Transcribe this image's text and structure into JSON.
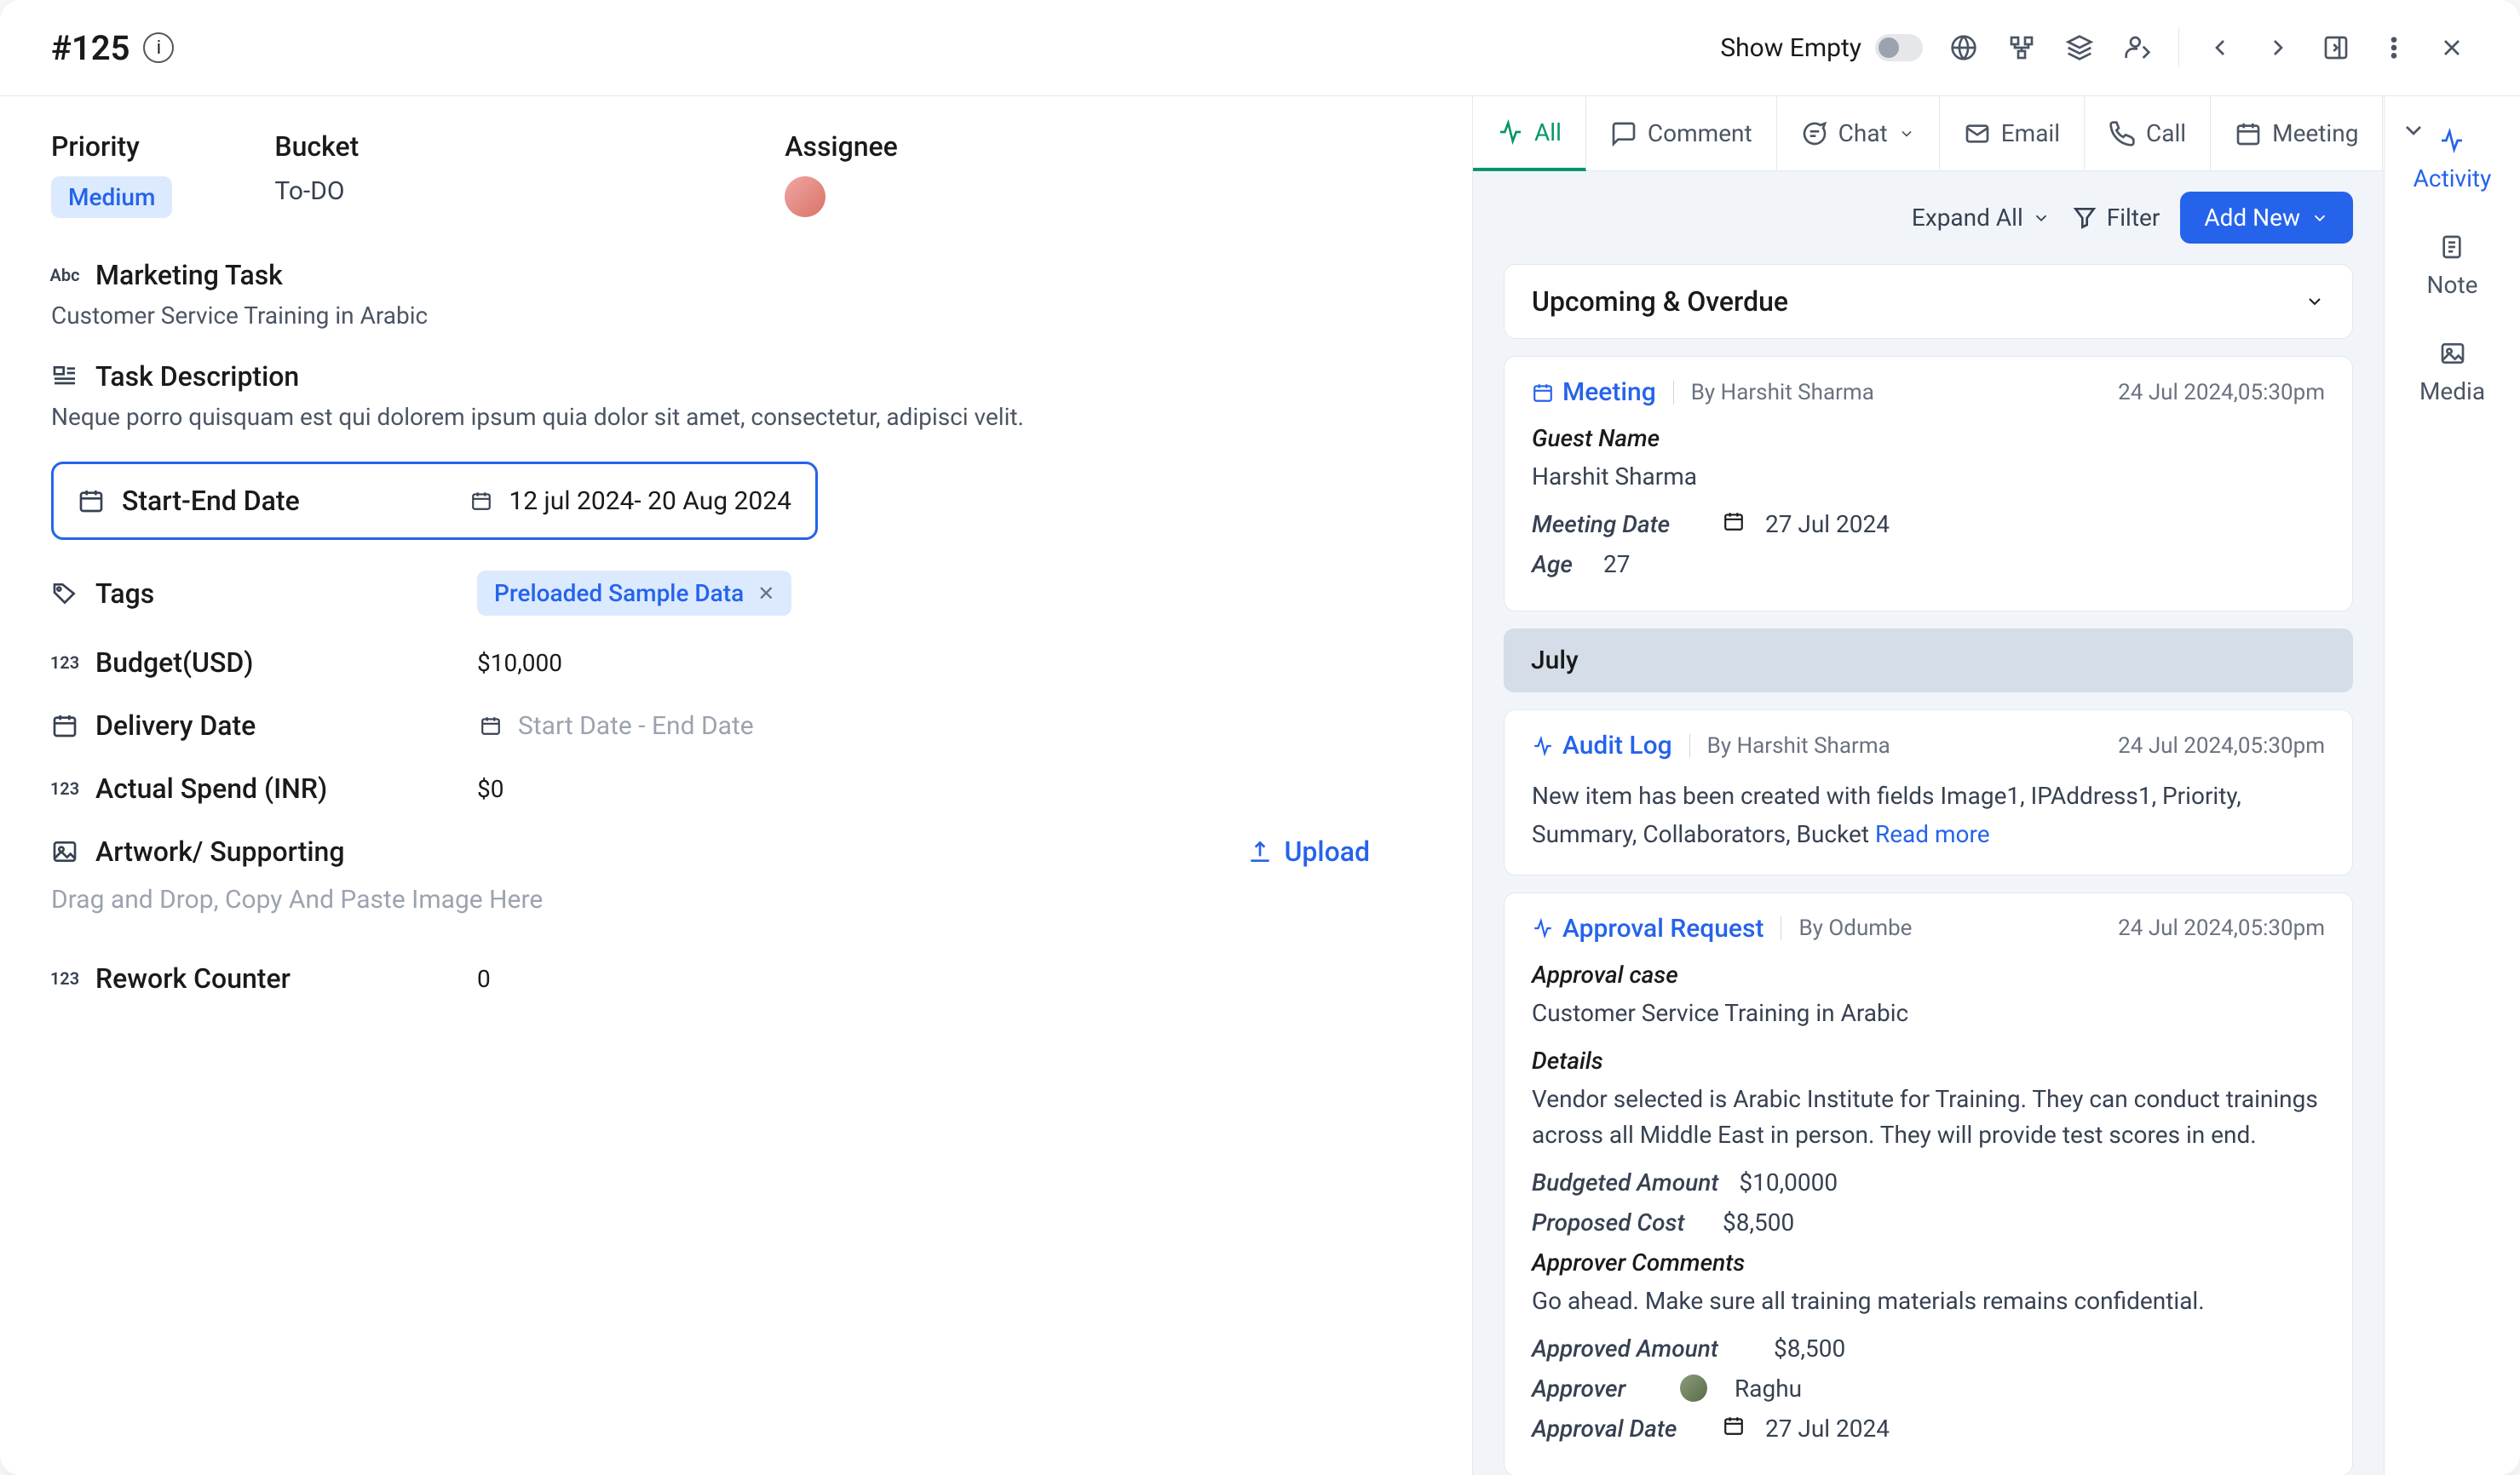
{
  "header": {
    "title": "#125",
    "showEmptyLabel": "Show Empty"
  },
  "topFields": {
    "priorityLabel": "Priority",
    "priorityValue": "Medium",
    "bucketLabel": "Bucket",
    "bucketValue": "To-DO",
    "assigneeLabel": "Assignee"
  },
  "taskTitle": {
    "label": "Marketing Task",
    "value": "Customer Service Training in Arabic"
  },
  "taskDesc": {
    "label": "Task Description",
    "value": "Neque porro quisquam est qui dolorem ipsum quia dolor sit amet, consectetur, adipisci velit."
  },
  "startEnd": {
    "label": "Start-End Date",
    "value": "12 jul 2024- 20 Aug 2024"
  },
  "tags": {
    "label": "Tags",
    "chip": "Preloaded Sample Data"
  },
  "budget": {
    "label": "Budget(USD)",
    "value": "$10,000"
  },
  "delivery": {
    "label": "Delivery Date",
    "placeholder": "Start Date - End Date"
  },
  "actualSpend": {
    "label": "Actual Spend (INR)",
    "value": "$0"
  },
  "artwork": {
    "label": "Artwork/ Supporting",
    "uploadLabel": "Upload",
    "dropHint": "Drag and Drop, Copy And Paste Image Here"
  },
  "rework": {
    "label": "Rework Counter",
    "value": "0"
  },
  "activityTabs": {
    "all": "All",
    "comment": "Comment",
    "chat": "Chat",
    "email": "Email",
    "call": "Call",
    "meeting": "Meeting"
  },
  "activityToolbar": {
    "expandAll": "Expand All",
    "filter": "Filter",
    "addNew": "Add New"
  },
  "sections": {
    "upcoming": "Upcoming & Overdue",
    "july": "July"
  },
  "meetingCard": {
    "type": "Meeting",
    "by": "By Harshit Sharma",
    "date": "24 Jul 2024,05:30pm",
    "guestNameLabel": "Guest Name",
    "guestName": "Harshit Sharma",
    "meetingDateLabel": "Meeting Date",
    "meetingDate": "27 Jul 2024",
    "ageLabel": "Age",
    "age": "27"
  },
  "auditCard": {
    "type": "Audit Log",
    "by": "By Harshit Sharma",
    "date": "24 Jul 2024,05:30pm",
    "text": "New item has been created with fields Image1, IPAddress1, Priority, Summary, Collaborators, Bucket ",
    "readMore": "Read more"
  },
  "approvalCard": {
    "type": "Approval Request",
    "by": "By Odumbe",
    "date": "24 Jul 2024,05:30pm",
    "caseLabel": "Approval case",
    "caseValue": "Customer Service Training in Arabic",
    "detailsLabel": "Details",
    "detailsValue": "Vendor selected is Arabic Institute for Training. They can conduct trainings across all Middle East in person. They will provide test scores in end.",
    "budgetedLabel": "Budgeted Amount",
    "budgetedValue": "$10,0000",
    "proposedLabel": "Proposed Cost",
    "proposedValue": "$8,500",
    "commentsLabel": "Approver Comments",
    "commentsValue": "Go ahead. Make sure all training materials remains confidential.",
    "approvedLabel": "Approved Amount",
    "approvedValue": "$8,500",
    "approverLabel": "Approver",
    "approverValue": "Raghu",
    "approvalDateLabel": "Approval Date",
    "approvalDateValue": "27 Jul 2024"
  },
  "rightRail": {
    "activity": "Activity",
    "note": "Note",
    "media": "Media"
  }
}
